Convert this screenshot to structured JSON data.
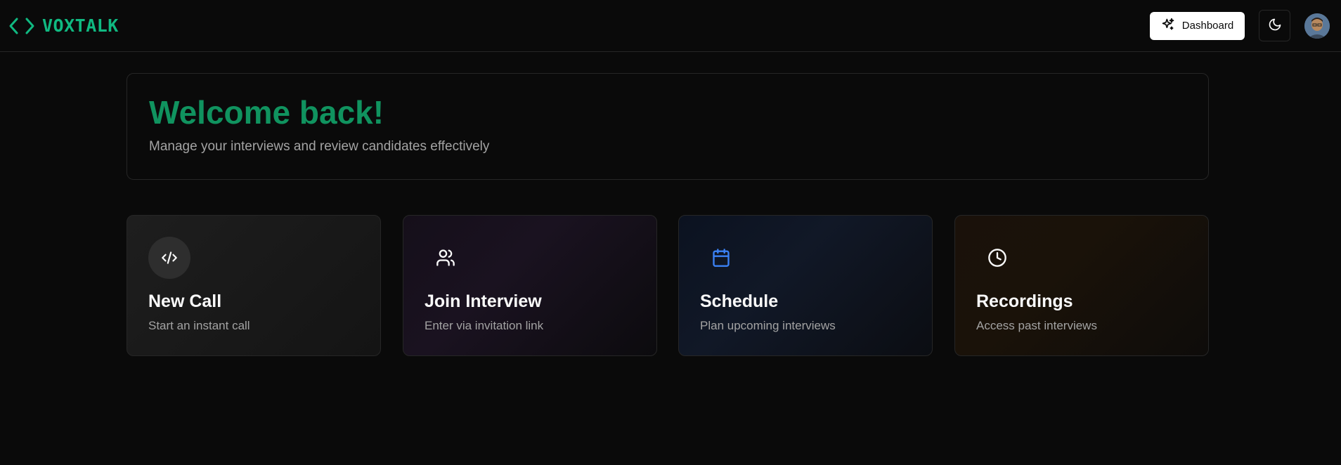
{
  "header": {
    "logo_text": "VOXTALK",
    "dashboard_label": "Dashboard",
    "logo_icon": "code-brackets-icon",
    "theme_icon": "moon-icon",
    "accent_color": "#10b981"
  },
  "welcome": {
    "title": "Welcome back!",
    "subtitle": "Manage your interviews and review candidates effectively"
  },
  "actions": [
    {
      "title": "New Call",
      "description": "Start an instant call",
      "icon": "code-icon"
    },
    {
      "title": "Join Interview",
      "description": "Enter via invitation link",
      "icon": "users-icon"
    },
    {
      "title": "Schedule",
      "description": "Plan upcoming interviews",
      "icon": "calendar-icon",
      "icon_color": "#3b82f6"
    },
    {
      "title": "Recordings",
      "description": "Access past interviews",
      "icon": "clock-icon"
    }
  ]
}
